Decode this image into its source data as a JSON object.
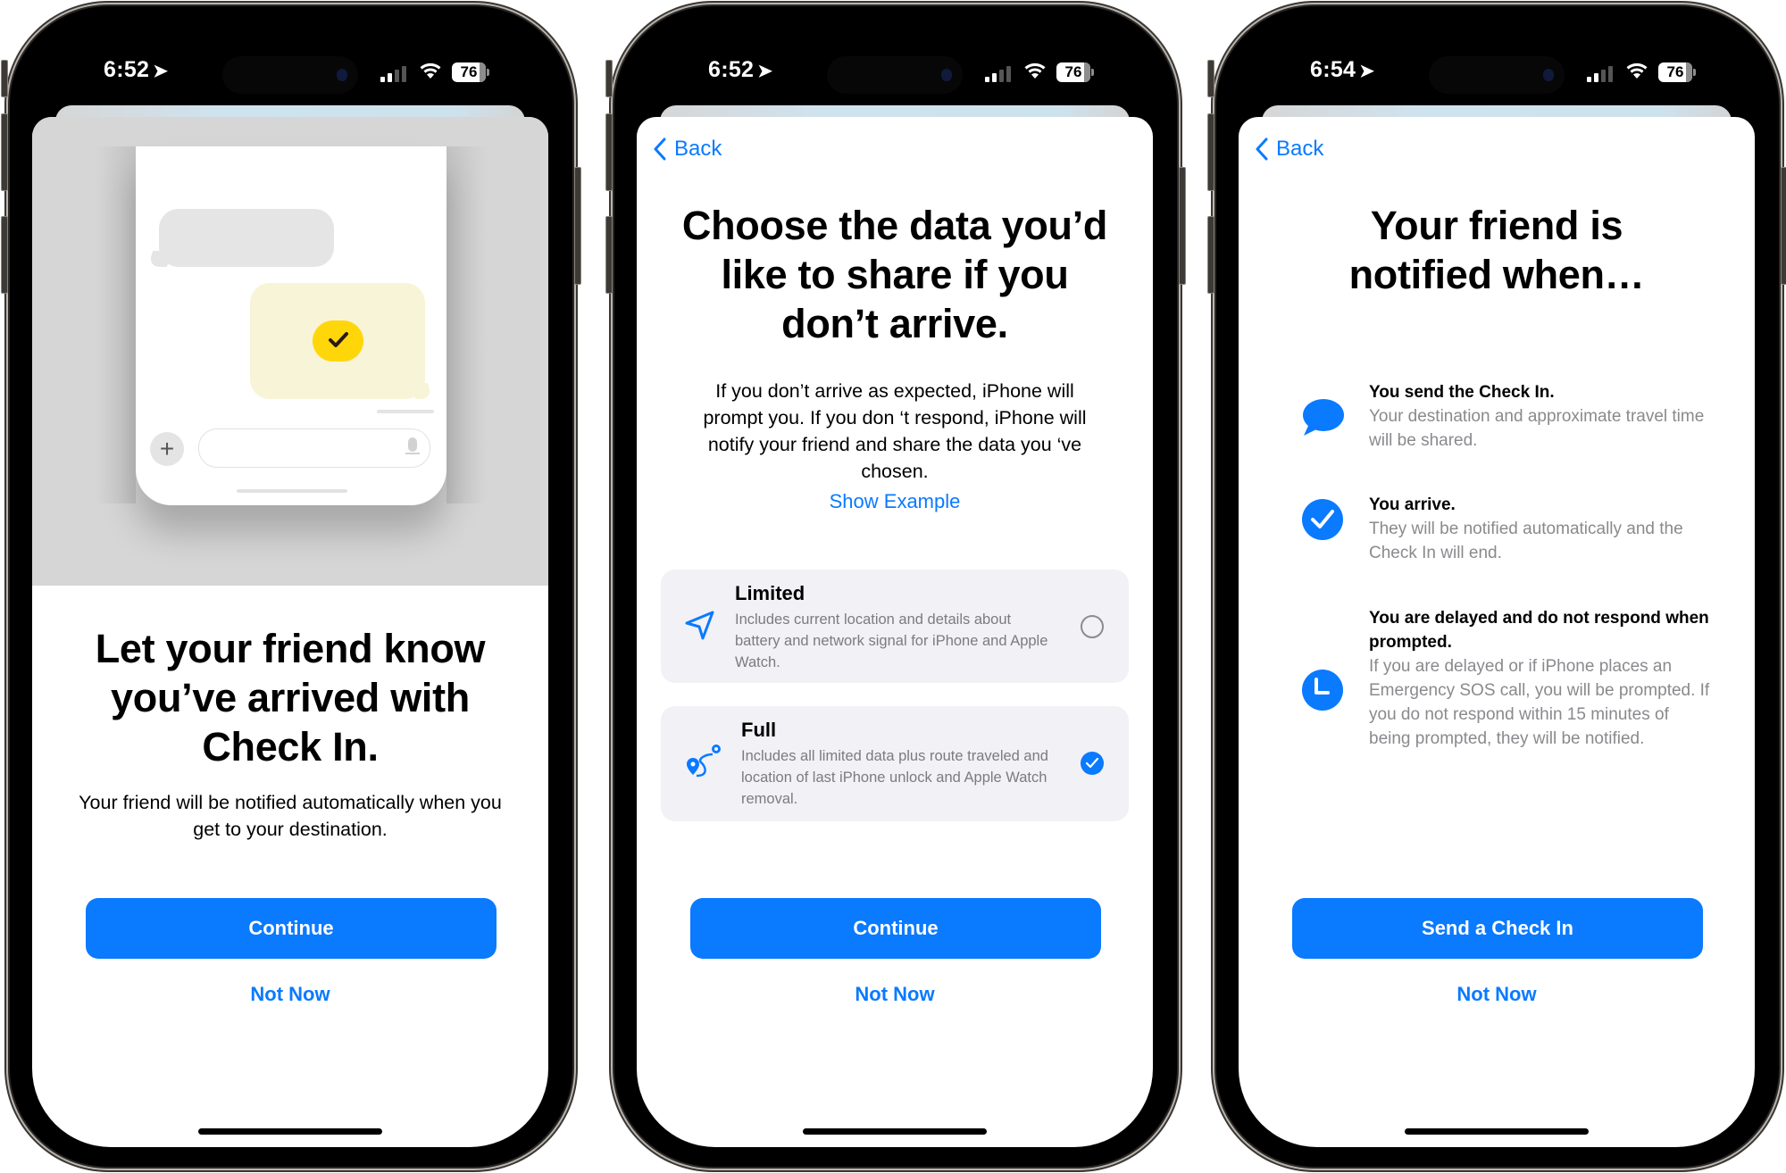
{
  "colors": {
    "accent": "#0A7AFF",
    "check_yellow": "#FFD60A",
    "secondary_text": "#8A8A8E",
    "card_bg": "#F1F1F6"
  },
  "phones": [
    {
      "status": {
        "time": "6:52",
        "battery": "76",
        "location_icon": "location-arrow-icon",
        "signal_icon": "cellular-signal-icon",
        "wifi_icon": "wifi-icon"
      },
      "illustration": {
        "description": "Messages conversation with Check In bubble",
        "icons": [
          "yellow-checkmark-icon",
          "plus-icon",
          "microphone-icon"
        ]
      },
      "title": "Let your friend know you’ve arrived with Check In.",
      "body": "Your friend will be notified automatically when you get to your destination.",
      "primary_button": "Continue",
      "secondary_button": "Not Now"
    },
    {
      "status": {
        "time": "6:52",
        "battery": "76",
        "location_icon": "location-arrow-icon",
        "signal_icon": "cellular-signal-icon",
        "wifi_icon": "wifi-icon"
      },
      "back_label": "Back",
      "title": "Choose the data you’d like to share if you don’t arrive.",
      "body": "If you don’t arrive as expected, iPhone will prompt you. If you don ‘t respond, iPhone will notify your friend and share the data you ‘ve chosen.",
      "show_example": "Show Example",
      "options": [
        {
          "title": "Limited",
          "description": "Includes current location and details about battery and network signal for iPhone and Apple Watch.",
          "icon": "location-arrow-icon",
          "selected": false
        },
        {
          "title": "Full",
          "description": "Includes all limited data plus route traveled and location of last iPhone unlock and Apple Watch removal.",
          "icon": "route-icon",
          "selected": true
        }
      ],
      "primary_button": "Continue",
      "secondary_button": "Not Now"
    },
    {
      "status": {
        "time": "6:54",
        "battery": "76",
        "location_icon": "location-arrow-icon",
        "signal_icon": "cellular-signal-icon",
        "wifi_icon": "wifi-icon"
      },
      "back_label": "Back",
      "title": "Your friend is notified when…",
      "items": [
        {
          "title": "You send the Check In.",
          "description": "Your destination and approximate travel time will be shared.",
          "icon": "message-bubble-icon"
        },
        {
          "title": "You arrive.",
          "description": "They will be notified automatically and the Check In will end.",
          "icon": "checkmark-circle-icon"
        },
        {
          "title": "You are delayed and do not respond when prompted.",
          "description": "If you are delayed or if iPhone places an Emergency SOS call, you will be prompted. If you do not respond within 15 minutes of being prompted, they will be notified.",
          "icon": "clock-icon"
        }
      ],
      "primary_button": "Send a Check In",
      "secondary_button": "Not Now"
    }
  ]
}
